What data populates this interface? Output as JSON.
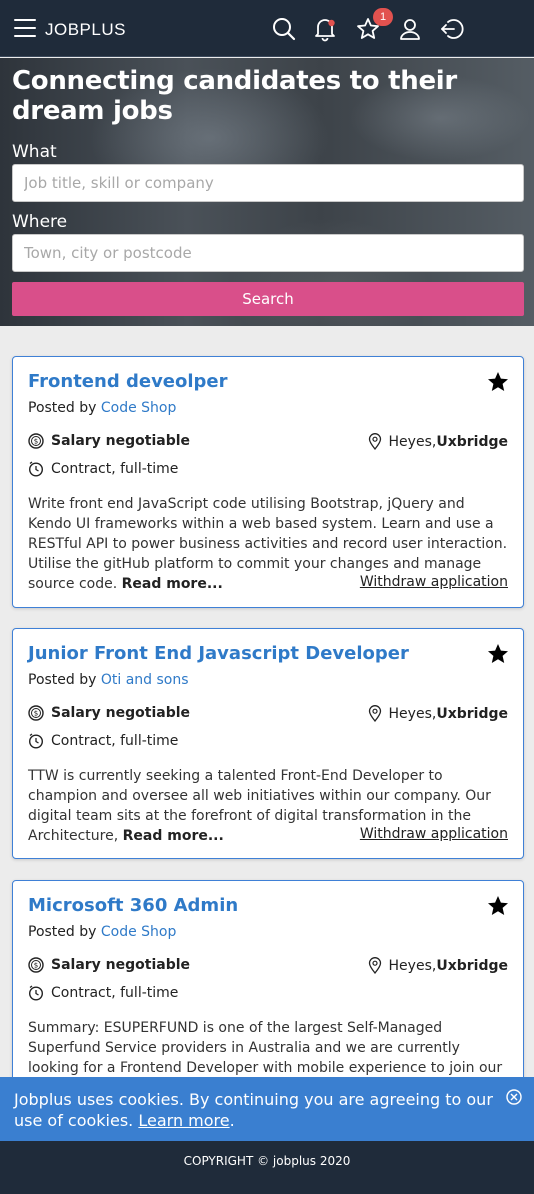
{
  "header": {
    "brand": "JOBPLUS",
    "favorites_count": "1",
    "icons": [
      "menu-icon",
      "search-icon",
      "bell-icon",
      "star-icon",
      "user-icon",
      "logout-icon"
    ]
  },
  "hero": {
    "title": "Connecting candidates to their dream jobs",
    "what_label": "What",
    "what_placeholder": "Job title, skill or company",
    "where_label": "Where",
    "where_placeholder": "Town, city or postcode",
    "search_label": "Search"
  },
  "jobs": [
    {
      "title": "Frontend deveolper",
      "posted_by_prefix": "Posted by",
      "company": "Code Shop",
      "salary": "Salary negotiable",
      "location_town": "Heyes,",
      "location_area": "Uxbridge",
      "contract": "Contract, full-time",
      "description": "Write front end JavaScript code utilising Bootstrap, jQuery and Kendo UI frameworks within a web based system. Learn and use a RESTful API to power business activities and record user interaction. Utilise the gitHub platform to commit your changes and manage source code.",
      "read_more": "Read more...",
      "withdraw": "Withdraw application"
    },
    {
      "title": "Junior Front End Javascript Developer",
      "posted_by_prefix": "Posted by",
      "company": "Oti and sons",
      "salary": "Salary negotiable",
      "location_town": "Heyes,",
      "location_area": "Uxbridge",
      "contract": "Contract, full-time",
      "description": "TTW is currently seeking a talented Front-End Developer to champion and oversee all web initiatives within our company. Our digital team sits at the forefront of digital transformation in the Architecture,",
      "read_more": "Read more...",
      "withdraw": "Withdraw application"
    },
    {
      "title": "Microsoft 360 Admin",
      "posted_by_prefix": "Posted by",
      "company": "Code Shop",
      "salary": "Salary negotiable",
      "location_town": "Heyes,",
      "location_area": "Uxbridge",
      "contract": "Contract, full-time",
      "description": "Summary: ESUPERFUND is one of the largest Self-Managed Superfund Service providers in Australia and we are currently looking for a Frontend Developer with mobile experience to join our growing IT department. The"
    }
  ],
  "cookie": {
    "text": "Jobplus uses cookies. By continuing you are agreeing to our use of cookies.",
    "link": "Learn more",
    "link_suffix": "."
  },
  "footer": {
    "copyright": "COPYRIGHT © jobplus 2020"
  },
  "colors": {
    "header_bg": "#1f2b3a",
    "accent_blue": "#2f7ac8",
    "search_pink": "#d94f8a",
    "badge_red": "#e2524f",
    "cookie_bg": "#3a7fd0"
  }
}
